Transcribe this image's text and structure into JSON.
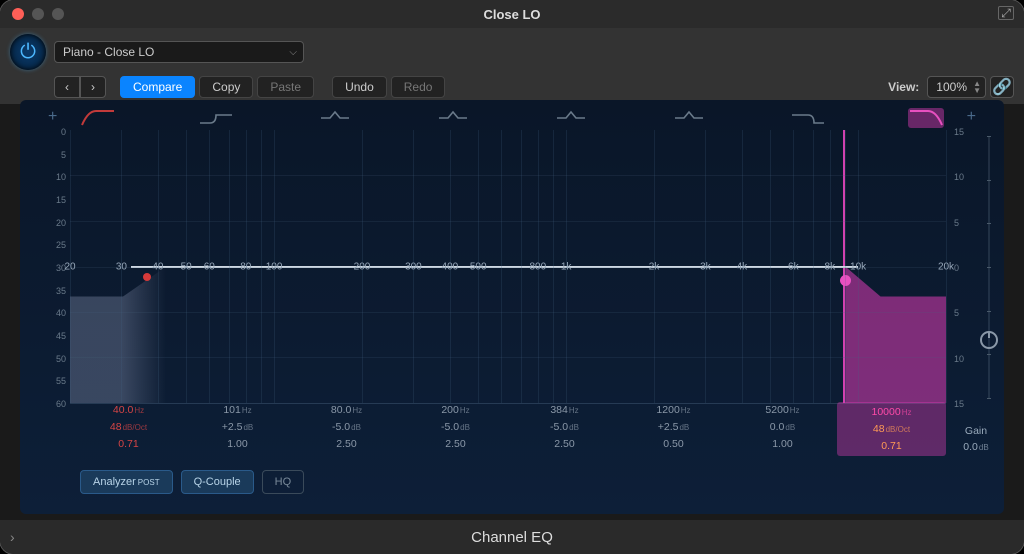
{
  "window": {
    "title": "Close LO"
  },
  "preset": "Piano - Close LO",
  "toolbar": {
    "compare": "Compare",
    "copy": "Copy",
    "paste": "Paste",
    "undo": "Undo",
    "redo": "Redo",
    "view_label": "View:",
    "zoom": "100%"
  },
  "left_scale": [
    "0",
    "5",
    "10",
    "15",
    "20",
    "25",
    "30",
    "35",
    "40",
    "45",
    "50",
    "55",
    "60"
  ],
  "right_scale": [
    "15",
    "10",
    "5",
    "0",
    "5",
    "10",
    "15"
  ],
  "freq_ticks": [
    "20",
    "30",
    "40",
    "50",
    "60",
    "80",
    "100",
    "200",
    "300",
    "400",
    "500",
    "800",
    "1k",
    "2k",
    "3k",
    "4k",
    "6k",
    "8k",
    "10k",
    "20k"
  ],
  "bands": [
    {
      "id": "hp",
      "freq": "40.0",
      "freq_unit": "Hz",
      "gain": "48",
      "gain_unit": "dB/Oct",
      "q": "0.71"
    },
    {
      "id": "ls",
      "freq": "101",
      "freq_unit": "Hz",
      "gain": "+2.5",
      "gain_unit": "dB",
      "q": "1.00"
    },
    {
      "id": "b1",
      "freq": "80.0",
      "freq_unit": "Hz",
      "gain": "-5.0",
      "gain_unit": "dB",
      "q": "2.50"
    },
    {
      "id": "b2",
      "freq": "200",
      "freq_unit": "Hz",
      "gain": "-5.0",
      "gain_unit": "dB",
      "q": "2.50"
    },
    {
      "id": "b3",
      "freq": "384",
      "freq_unit": "Hz",
      "gain": "-5.0",
      "gain_unit": "dB",
      "q": "2.50"
    },
    {
      "id": "b4",
      "freq": "1200",
      "freq_unit": "Hz",
      "gain": "+2.5",
      "gain_unit": "dB",
      "q": "0.50"
    },
    {
      "id": "hs",
      "freq": "5200",
      "freq_unit": "Hz",
      "gain": "0.0",
      "gain_unit": "dB",
      "q": "1.00"
    },
    {
      "id": "lp",
      "freq": "10000",
      "freq_unit": "Hz",
      "gain": "48",
      "gain_unit": "dB/Oct",
      "q": "0.71"
    }
  ],
  "gain": {
    "label": "Gain",
    "value": "0.0",
    "unit": "dB"
  },
  "bottom": {
    "analyzer": "Analyzer",
    "analyzer_mode": "POST",
    "qcouple": "Q-Couple",
    "hq": "HQ"
  },
  "footer": "Channel EQ",
  "chart_data": {
    "type": "line",
    "title": "Channel EQ — Close LO",
    "x_scale": "log_hz",
    "x_range": [
      20,
      20000
    ],
    "y_left_label": "Analyzer (dB)",
    "y_left_range": [
      -60,
      0
    ],
    "y_right_label": "Gain (dB)",
    "y_right_range": [
      -15,
      15
    ],
    "filters": [
      {
        "type": "highpass",
        "enabled": true,
        "freq_hz": 40.0,
        "slope_db_oct": 48,
        "q": 0.71
      },
      {
        "type": "lowshelf",
        "enabled": false,
        "freq_hz": 101,
        "gain_db": 2.5,
        "q": 1.0
      },
      {
        "type": "bell",
        "enabled": false,
        "freq_hz": 80.0,
        "gain_db": -5.0,
        "q": 2.5
      },
      {
        "type": "bell",
        "enabled": false,
        "freq_hz": 200,
        "gain_db": -5.0,
        "q": 2.5
      },
      {
        "type": "bell",
        "enabled": false,
        "freq_hz": 384,
        "gain_db": -5.0,
        "q": 2.5
      },
      {
        "type": "bell",
        "enabled": false,
        "freq_hz": 1200,
        "gain_db": 2.5,
        "q": 0.5
      },
      {
        "type": "highshelf",
        "enabled": false,
        "freq_hz": 5200,
        "gain_db": 0.0,
        "q": 1.0
      },
      {
        "type": "lowpass",
        "enabled": true,
        "freq_hz": 10000,
        "slope_db_oct": 48,
        "q": 0.71
      }
    ],
    "output_gain_db": 0.0
  }
}
